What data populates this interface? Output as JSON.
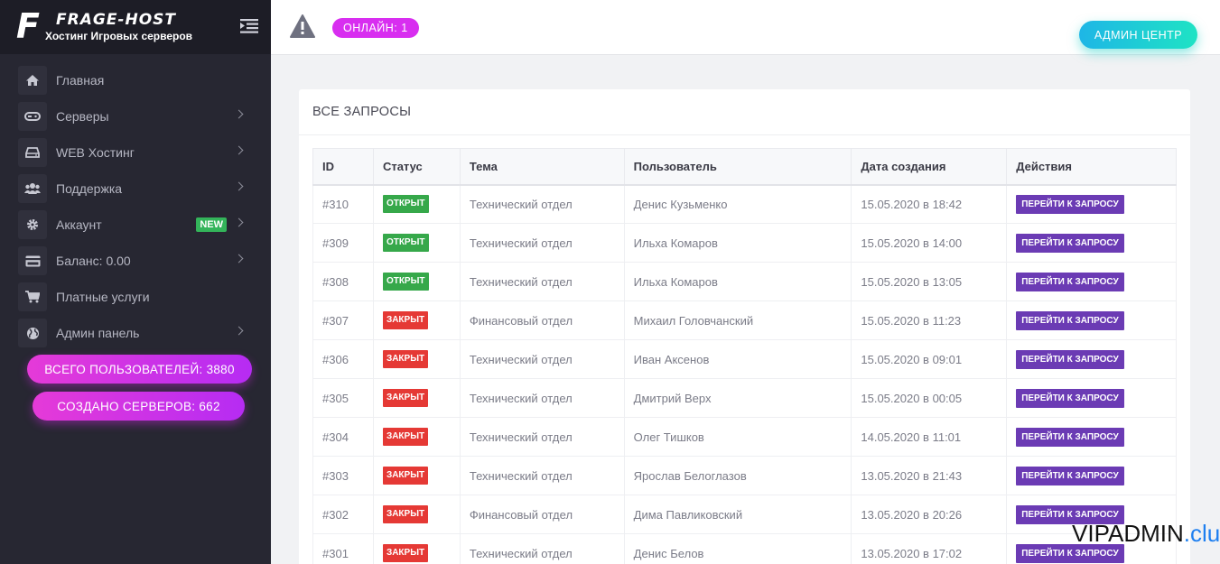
{
  "brand": {
    "logo_letter": "F",
    "name": "FRAGE-HOST",
    "subtitle": "Хостинг Игровых серверов"
  },
  "sidebar": {
    "items": [
      {
        "label": "Главная",
        "icon": "home-icon",
        "chevron": false
      },
      {
        "label": "Серверы",
        "icon": "gamepad-icon",
        "chevron": true
      },
      {
        "label": "WEB Хостинг",
        "icon": "hdd-icon",
        "chevron": true
      },
      {
        "label": "Поддержка",
        "icon": "users-icon",
        "chevron": true
      },
      {
        "label": "Аккаунт",
        "icon": "gear-icon",
        "chevron": true,
        "badge": "NEW"
      },
      {
        "label": "Баланс: 0.00",
        "icon": "credit-card-icon",
        "chevron": true
      },
      {
        "label": "Платные услуги",
        "icon": "cart-icon",
        "chevron": false
      },
      {
        "label": "Админ панель",
        "icon": "globe-icon",
        "chevron": true
      }
    ],
    "stats": {
      "users": "ВСЕГО ПОЛЬЗОВАТЕЛЕЙ: 3880",
      "servers": "СОЗДАНО СЕРВЕРОВ: 662"
    }
  },
  "topbar": {
    "online": "ОНЛАЙН: 1",
    "admin_button": "АДМИН ЦЕНТР"
  },
  "card": {
    "title": "ВСЕ ЗАПРОСЫ",
    "columns": [
      "ID",
      "Статус",
      "Тема",
      "Пользователь",
      "Дата создания",
      "Действия"
    ],
    "rows": [
      {
        "id": "#310",
        "status": "ОТКРЫТ",
        "state": "open",
        "topic": "Технический отдел",
        "user": "Денис Кузьменко",
        "date": "15.05.2020 в 18:42",
        "action": "ПЕРЕЙТИ К ЗАПРОСУ"
      },
      {
        "id": "#309",
        "status": "ОТКРЫТ",
        "state": "open",
        "topic": "Технический отдел",
        "user": "Ильха Комаров",
        "date": "15.05.2020 в 14:00",
        "action": "ПЕРЕЙТИ К ЗАПРОСУ"
      },
      {
        "id": "#308",
        "status": "ОТКРЫТ",
        "state": "open",
        "topic": "Технический отдел",
        "user": "Ильха Комаров",
        "date": "15.05.2020 в 13:05",
        "action": "ПЕРЕЙТИ К ЗАПРОСУ"
      },
      {
        "id": "#307",
        "status": "ЗАКРЫТ",
        "state": "closed",
        "topic": "Финансовый отдел",
        "user": "Михаил Головчанский",
        "date": "15.05.2020 в 11:23",
        "action": "ПЕРЕЙТИ К ЗАПРОСУ"
      },
      {
        "id": "#306",
        "status": "ЗАКРЫТ",
        "state": "closed",
        "topic": "Технический отдел",
        "user": "Иван Аксенов",
        "date": "15.05.2020 в 09:01",
        "action": "ПЕРЕЙТИ К ЗАПРОСУ"
      },
      {
        "id": "#305",
        "status": "ЗАКРЫТ",
        "state": "closed",
        "topic": "Технический отдел",
        "user": "Дмитрий Верх",
        "date": "15.05.2020 в 00:05",
        "action": "ПЕРЕЙТИ К ЗАПРОСУ"
      },
      {
        "id": "#304",
        "status": "ЗАКРЫТ",
        "state": "closed",
        "topic": "Технический отдел",
        "user": "Олег Тишков",
        "date": "14.05.2020 в 11:01",
        "action": "ПЕРЕЙТИ К ЗАПРОСУ"
      },
      {
        "id": "#303",
        "status": "ЗАКРЫТ",
        "state": "closed",
        "topic": "Технический отдел",
        "user": "Ярослав Белоглазов",
        "date": "13.05.2020 в 21:43",
        "action": "ПЕРЕЙТИ К ЗАПРОСУ"
      },
      {
        "id": "#302",
        "status": "ЗАКРЫТ",
        "state": "closed",
        "topic": "Финансовый отдел",
        "user": "Дима Павликовский",
        "date": "13.05.2020 в 20:26",
        "action": "ПЕРЕЙТИ К ЗАПРОСУ"
      },
      {
        "id": "#301",
        "status": "ЗАКРЫТ",
        "state": "closed",
        "topic": "Технический отдел",
        "user": "Денис Белов",
        "date": "13.05.2020 в 17:02",
        "action": "ПЕРЕЙТИ К ЗАПРОСУ"
      }
    ]
  },
  "watermark": {
    "main": "VIPADMIN",
    "suffix": ".club"
  },
  "colors": {
    "sidebar_bg": "#272732",
    "accent_pink": "#d82ef0",
    "accent_teal": "#1ee3c4",
    "open_green": "#36a84a",
    "closed_red": "#e53935",
    "action_purple": "#6b3bb4"
  }
}
